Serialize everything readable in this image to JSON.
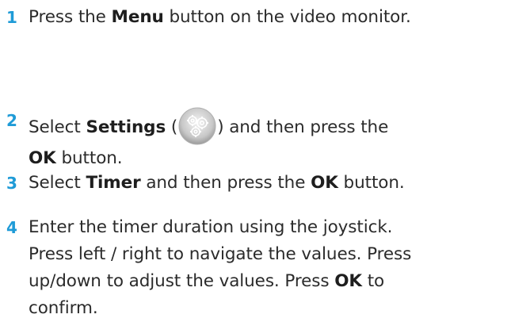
{
  "steps": [
    {
      "number": "1",
      "pre": "Press the ",
      "bold1": "Menu",
      "post": " button on the video monitor."
    },
    {
      "number": "2",
      "pre": "Select ",
      "bold1": "Settings",
      "paren_open": " (",
      "icon": "settings-gears-icon",
      "paren_close": ") and then press the",
      "bold2": "OK",
      "post": " button."
    },
    {
      "number": "3",
      "pre": "Select ",
      "bold1": "Timer",
      "mid": " and then press the ",
      "bold2": "OK",
      "post": " button."
    },
    {
      "number": "4",
      "line1": "Enter the timer duration using the joystick.",
      "line2": "Press left / right to navigate the values. Press",
      "line3_pre": "up/down to adjust the values. Press ",
      "bold1": "OK",
      "line3_post": " to",
      "line4": "confirm."
    }
  ]
}
